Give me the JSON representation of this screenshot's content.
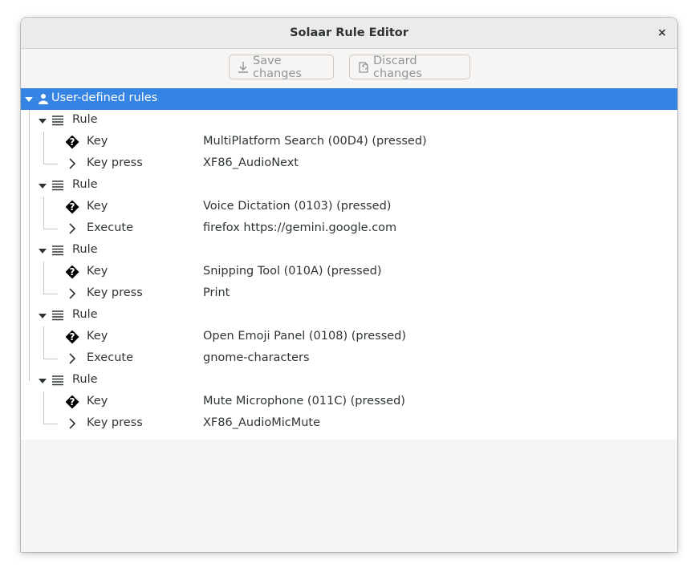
{
  "window": {
    "title": "Solaar Rule Editor",
    "close_glyph": "×"
  },
  "toolbar": {
    "save_label": "Save changes",
    "discard_label": "Discard changes"
  },
  "tree": {
    "root_label": "User-defined rules",
    "rules": [
      {
        "label": "Rule",
        "children": [
          {
            "kind": "Key",
            "value": "MultiPlatform Search (00D4) (pressed)"
          },
          {
            "kind": "Key press",
            "value": "XF86_AudioNext"
          }
        ]
      },
      {
        "label": "Rule",
        "children": [
          {
            "kind": "Key",
            "value": "Voice Dictation (0103) (pressed)"
          },
          {
            "kind": "Execute",
            "value": "firefox https://gemini.google.com"
          }
        ]
      },
      {
        "label": "Rule",
        "children": [
          {
            "kind": "Key",
            "value": "Snipping Tool (010A) (pressed)"
          },
          {
            "kind": "Key press",
            "value": "Print"
          }
        ]
      },
      {
        "label": "Rule",
        "children": [
          {
            "kind": "Key",
            "value": "Open Emoji Panel (0108) (pressed)"
          },
          {
            "kind": "Execute",
            "value": "gnome-characters"
          }
        ]
      },
      {
        "label": "Rule",
        "children": [
          {
            "kind": "Key",
            "value": "Mute Microphone (011C) (pressed)"
          },
          {
            "kind": "Key press",
            "value": "XF86_AudioMicMute"
          }
        ]
      }
    ]
  },
  "colors": {
    "selection": "#3584e4",
    "text": "#2e3436",
    "disabled_text": "#929595"
  },
  "icons": {
    "root": "user-icon",
    "rule": "list-icon",
    "key": "unknown-glyph-icon",
    "action": "chevron-right-icon"
  }
}
